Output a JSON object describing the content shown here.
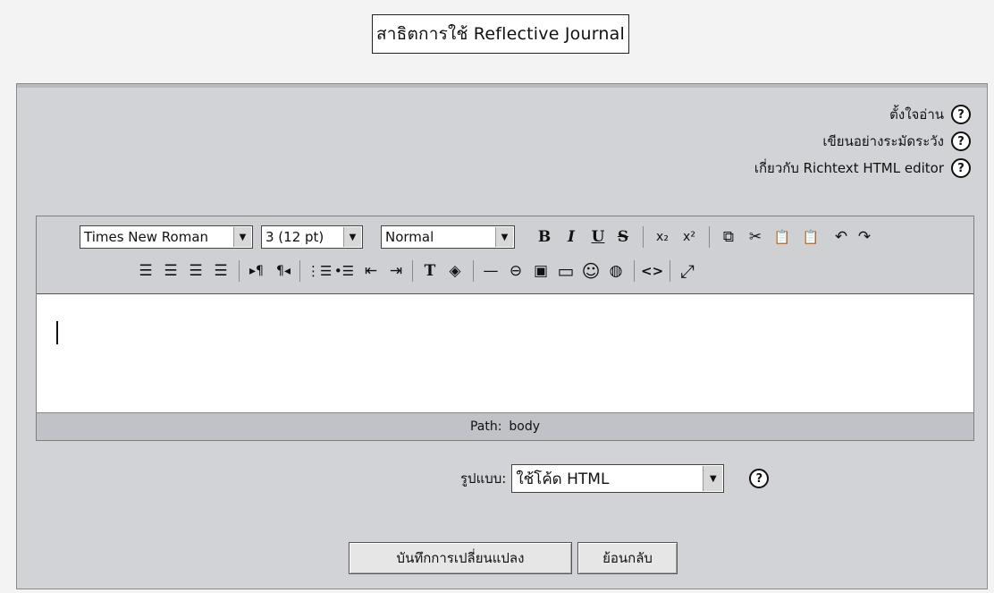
{
  "title": "สาธิตการใช้ Reflective Journal",
  "help_links": [
    {
      "label": "ตั้งใจอ่าน",
      "icon": "?"
    },
    {
      "label": "เขียนอย่างระมัดระวัง",
      "icon": "?"
    },
    {
      "label": "เกี่ยวกับ Richtext HTML editor",
      "icon": "?"
    }
  ],
  "toolbar": {
    "font_name": "Times New Roman",
    "font_size": "3 (12 pt)",
    "block_format": "Normal",
    "dropdown_arrow": "▼",
    "buttons": {
      "bold": "B",
      "italic": "I",
      "underline": "U",
      "strike": "S",
      "subscript": "x₂",
      "superscript": "x²",
      "copy": "⧉",
      "cut": "✂",
      "paste": "📋",
      "undo": "↶",
      "redo": "↷",
      "align_left": "☰",
      "align_center": "☰",
      "align_right": "☰",
      "justify": "☰",
      "ltr": "▸¶",
      "rtl": "¶◂",
      "ordered_list": "⋮☰",
      "unordered_list": "•☰",
      "outdent": "⇤",
      "indent": "⇥",
      "text_color": "T",
      "bg_color": "◈",
      "hr": "—",
      "link": "⊖",
      "image": "▣",
      "table": "▭",
      "smiley": "☺",
      "special": "◍",
      "html_source": "<>",
      "fullscreen": "⤢"
    }
  },
  "editor": {
    "path_label": "Path:",
    "path_value": "body"
  },
  "format": {
    "label": "รูปแบบ:",
    "selected": "ใช้โค้ด HTML",
    "icon": "?"
  },
  "actions": {
    "save": "บันทึกการเปลี่ยนแปลง",
    "back": "ย้อนกลับ"
  }
}
